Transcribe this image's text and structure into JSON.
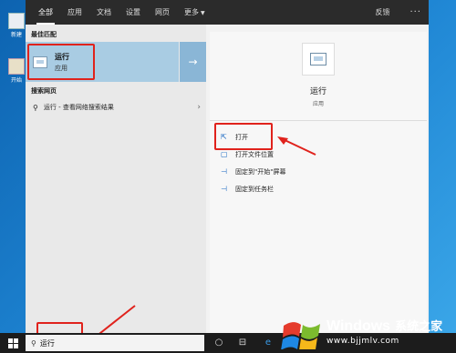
{
  "desktop": {
    "icons": [
      {
        "label": "新建"
      },
      {
        "label": "开始"
      }
    ]
  },
  "search": {
    "tabs": [
      {
        "label": "全部",
        "active": true
      },
      {
        "label": "应用"
      },
      {
        "label": "文档"
      },
      {
        "label": "设置"
      },
      {
        "label": "网页"
      },
      {
        "label": "更多"
      }
    ],
    "feedback_label": "反馈",
    "more_label": "···",
    "best_match_title": "最佳匹配",
    "best_match": {
      "name": "运行",
      "type": "应用"
    },
    "web_section_title": "搜索网页",
    "web_result": "运行 - 查看网络搜索结果",
    "detail": {
      "name": "运行",
      "type": "应用"
    },
    "actions": [
      {
        "label": "打开",
        "icon": "open-icon"
      },
      {
        "label": "打开文件位置",
        "icon": "file-location-icon"
      },
      {
        "label": "固定到\"开始\"屏幕",
        "icon": "pin-start-icon"
      },
      {
        "label": "固定到任务栏",
        "icon": "pin-taskbar-icon"
      }
    ]
  },
  "taskbar": {
    "search_value": "运行"
  },
  "watermark": {
    "brand": "Windows",
    "cn": "系统之家",
    "url": "www.bjjmlv.com"
  },
  "colors": {
    "annotation_red": "#e0221c",
    "highlight_blue": "#a9cce3"
  }
}
